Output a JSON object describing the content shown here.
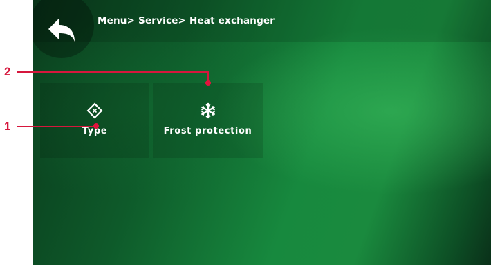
{
  "header": {
    "breadcrumb": "Menu> Service> Heat exchanger"
  },
  "tiles": [
    {
      "label": "Type",
      "icon": "diamond-x-icon"
    },
    {
      "label": "Frost protection",
      "icon": "snowflake-icon"
    }
  ],
  "callouts": [
    {
      "number": "1"
    },
    {
      "number": "2"
    }
  ],
  "colors": {
    "callout": "#d6173d",
    "background_green": "#17893e"
  }
}
